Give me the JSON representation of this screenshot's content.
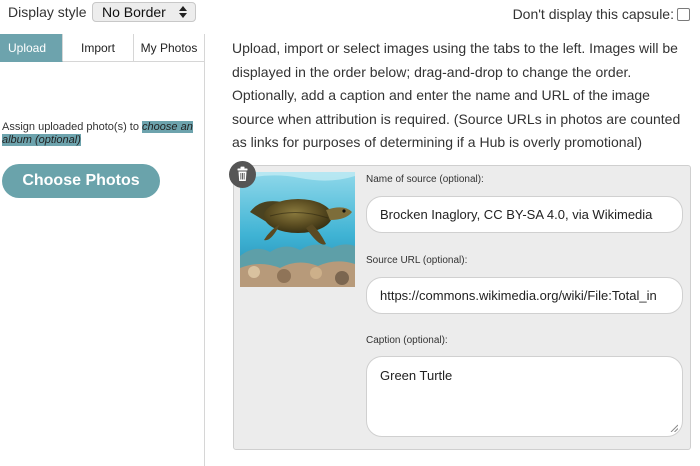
{
  "top_bar": {
    "display_style_label": "Display style",
    "display_style_value": "No Border",
    "capsule_label": "Don't display this capsule:"
  },
  "left_panel": {
    "tabs": [
      {
        "label": "Upload",
        "active": true
      },
      {
        "label": "Import",
        "active": false
      },
      {
        "label": "My Photos",
        "active": false
      }
    ],
    "assign_text": "Assign uploaded photo(s) to ",
    "assign_link": "choose an album (optional)",
    "choose_button": "Choose Photos"
  },
  "main": {
    "intro": "Upload, import or select images using the tabs to the left. Images will be displayed in the order below; drag-and-drop to change the order. Optionally, add a caption and enter the name and URL of the image source when attribution is required. (Source URLs in photos are counted as links for purposes of determining if a Hub is overly promotional)",
    "photo": {
      "source_name_label": "Name of source (optional):",
      "source_name_value": "Brocken Inaglory, CC BY-SA 4.0, via Wikimedia",
      "source_url_label": "Source URL (optional):",
      "source_url_value": "https://commons.wikimedia.org/wiki/File:Total_in",
      "caption_label": "Caption (optional):",
      "caption_value": "Green Turtle"
    }
  },
  "colors": {
    "accent": "#6da3ad",
    "panel_bg": "#ececec",
    "trash_bg": "#555555"
  },
  "icons": {
    "trash": "trash-icon",
    "select_arrows": "select-arrows-icon",
    "resize": "resize-handle-icon"
  }
}
